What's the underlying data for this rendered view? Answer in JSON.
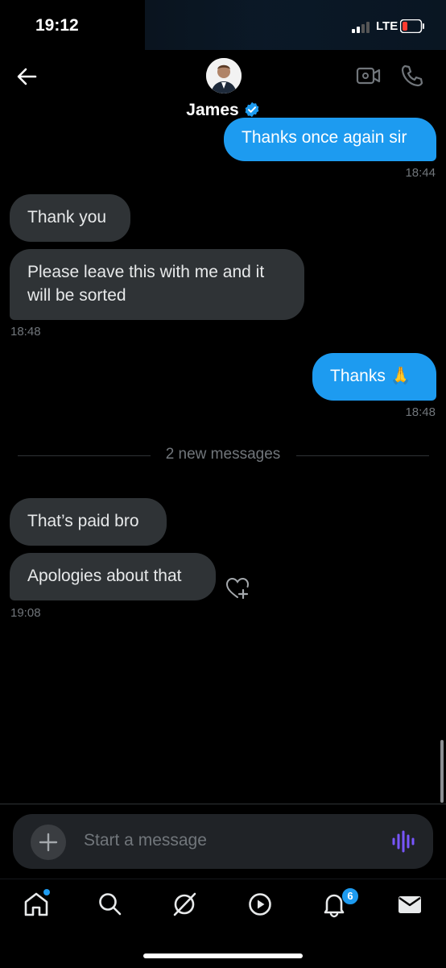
{
  "status_bar": {
    "time": "19:12",
    "network": "LTE"
  },
  "header": {
    "name": "James",
    "verified": true
  },
  "icons": {
    "back": "arrow-left-icon",
    "video": "video-camera-icon",
    "call": "phone-icon",
    "verified": "verified-badge-icon",
    "react": "heart-plus-icon",
    "voice": "audio-wave-icon",
    "plus": "plus-icon"
  },
  "messages": [
    {
      "id": "m1",
      "direction": "out",
      "text": "Thanks once again sir",
      "time": "18:44"
    },
    {
      "id": "m2",
      "direction": "in",
      "text": "Thank you"
    },
    {
      "id": "m3",
      "direction": "in",
      "text": "Please leave this with me and it will be sorted",
      "time": "18:48"
    },
    {
      "id": "m4",
      "direction": "out",
      "text": "Thanks 🙏",
      "time": "18:48"
    },
    {
      "id": "m5",
      "direction": "in",
      "text": "That’s paid bro"
    },
    {
      "id": "m6",
      "direction": "in",
      "text": "Apologies about that",
      "time": "19:08"
    }
  ],
  "new_messages_divider": "2 new messages",
  "composer": {
    "placeholder": "Start a message"
  },
  "tabbar": {
    "items": [
      "home",
      "search",
      "grok",
      "video",
      "notifications",
      "messages"
    ],
    "notifications_badge": "6"
  },
  "colors": {
    "accent": "#1d9bf0",
    "incoming_bubble": "#2f3336",
    "background": "#000000",
    "voice_icon": "#7856ff"
  }
}
